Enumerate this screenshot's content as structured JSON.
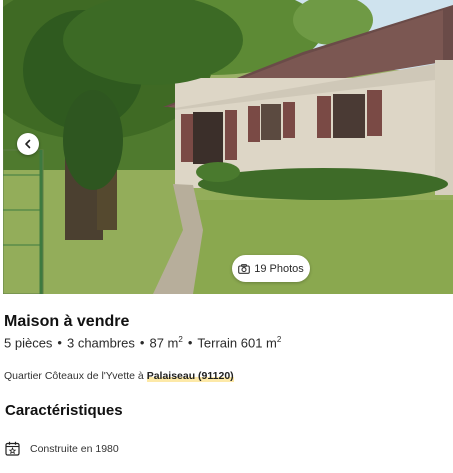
{
  "gallery": {
    "photo_alt": "House exterior with garden",
    "photos_count_label": "19 Photos",
    "prev_icon": "chevron-left-icon",
    "camera_icon": "camera-icon"
  },
  "listing": {
    "title": "Maison à vendre",
    "rooms": "5 pièces",
    "bedrooms": "3 chambres",
    "area": "87 m",
    "area_exp": "2",
    "land": "Terrain 601 m",
    "land_exp": "2",
    "separator": "•",
    "location_prefix": "Quartier Côteaux de l'Yvette à",
    "city": "Palaiseau (91120)"
  },
  "characteristics": {
    "title": "Caractéristiques",
    "items": [
      {
        "icon": "calendar-icon",
        "label": "Construite en 1980"
      }
    ]
  }
}
